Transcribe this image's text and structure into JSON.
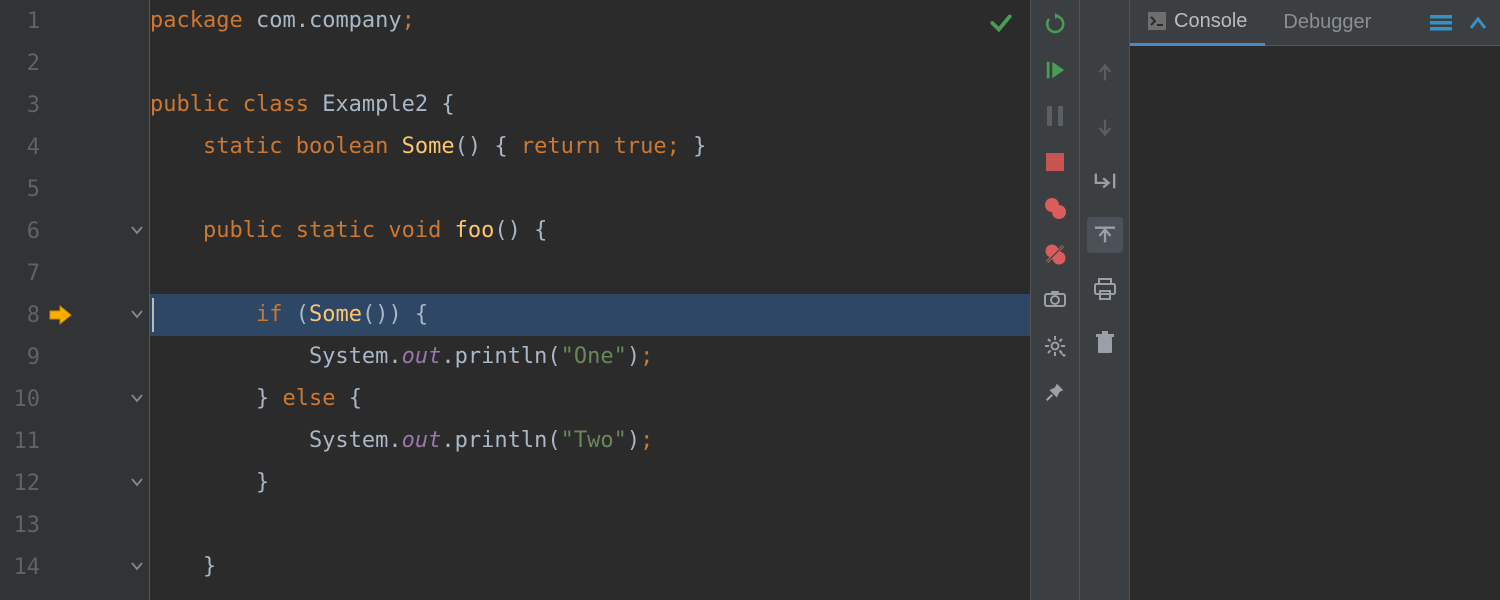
{
  "editor": {
    "lines": [
      {
        "n": 1,
        "tokens": [
          [
            "kw",
            "package "
          ],
          [
            "plain",
            "com.company"
          ],
          [
            "semi",
            ";"
          ]
        ]
      },
      {
        "n": 2,
        "tokens": []
      },
      {
        "n": 3,
        "tokens": [
          [
            "kw",
            "public class "
          ],
          [
            "plain",
            "Example2 {"
          ]
        ]
      },
      {
        "n": 4,
        "tokens": [
          [
            "plain",
            "    "
          ],
          [
            "kw",
            "static boolean "
          ],
          [
            "fn",
            "Some"
          ],
          [
            "plain",
            "() { "
          ],
          [
            "kw",
            "return true"
          ],
          [
            "semi",
            "; "
          ],
          [
            "plain",
            "}"
          ]
        ]
      },
      {
        "n": 5,
        "tokens": []
      },
      {
        "n": 6,
        "fold": true,
        "tokens": [
          [
            "plain",
            "    "
          ],
          [
            "kw",
            "public static void "
          ],
          [
            "fn",
            "foo"
          ],
          [
            "plain",
            "() {"
          ]
        ]
      },
      {
        "n": 7,
        "tokens": []
      },
      {
        "n": 8,
        "current": true,
        "exec": true,
        "fold": true,
        "tokens": [
          [
            "plain",
            "        "
          ],
          [
            "kw",
            "if "
          ],
          [
            "plain",
            "("
          ],
          [
            "fn",
            "Some"
          ],
          [
            "plain",
            "()) {"
          ]
        ]
      },
      {
        "n": 9,
        "tokens": [
          [
            "plain",
            "            System."
          ],
          [
            "field",
            "out"
          ],
          [
            "plain",
            ".println("
          ],
          [
            "str",
            "\"One\""
          ],
          [
            "plain",
            ")"
          ],
          [
            "semi",
            ";"
          ]
        ]
      },
      {
        "n": 10,
        "fold": true,
        "tokens": [
          [
            "plain",
            "        } "
          ],
          [
            "kw",
            "else "
          ],
          [
            "plain",
            "{"
          ]
        ]
      },
      {
        "n": 11,
        "tokens": [
          [
            "plain",
            "            System."
          ],
          [
            "field",
            "out"
          ],
          [
            "plain",
            ".println("
          ],
          [
            "str",
            "\"Two\""
          ],
          [
            "plain",
            ")"
          ],
          [
            "semi",
            ";"
          ]
        ]
      },
      {
        "n": 12,
        "fold": true,
        "tokens": [
          [
            "plain",
            "        }"
          ]
        ]
      },
      {
        "n": 13,
        "tokens": []
      },
      {
        "n": 14,
        "fold": true,
        "tokens": [
          [
            "plain",
            "    }"
          ]
        ]
      }
    ]
  },
  "run_toolbar": {
    "rerun": {
      "name": "rerun-icon"
    },
    "resume": {
      "name": "resume-icon"
    },
    "pause": {
      "name": "pause-icon"
    },
    "stop": {
      "name": "stop-icon"
    },
    "breakpts": {
      "name": "view-breakpoints-icon"
    },
    "mute": {
      "name": "mute-breakpoints-icon"
    },
    "camera": {
      "name": "thread-dump-icon"
    },
    "settings": {
      "name": "settings-icon"
    },
    "pin": {
      "name": "pin-icon"
    }
  },
  "step_toolbar": {
    "step_over": {
      "name": "step-over-icon"
    },
    "step_into": {
      "name": "step-into-icon"
    },
    "force_into": {
      "name": "force-step-into-icon"
    },
    "step_out": {
      "name": "step-out-icon"
    },
    "print": {
      "name": "print-icon"
    },
    "trash": {
      "name": "trash-icon"
    }
  },
  "tabs": {
    "console": "Console",
    "debugger": "Debugger"
  }
}
